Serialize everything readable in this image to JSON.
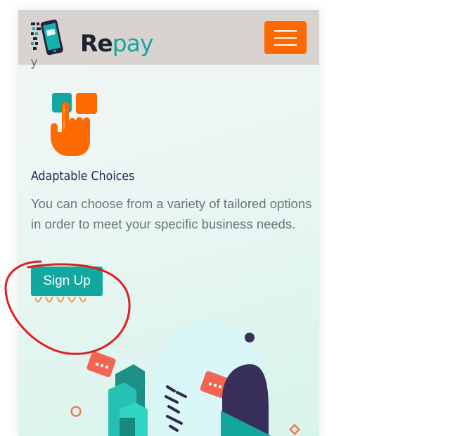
{
  "header": {
    "logo_text_primary": "Re",
    "logo_text_accent": "pay",
    "logo_icon": "phone-payment-icon",
    "menu_icon": "hamburger-icon"
  },
  "feature": {
    "cut_off_text": "y",
    "icon": "tap-choice-icon",
    "title": "Adaptable Choices",
    "description": "You can choose from a variety of tailored options in order to meet your specific business needs."
  },
  "cta": {
    "signup_label": "Sign Up"
  },
  "colors": {
    "accent_orange": "#ff6a00",
    "brand_teal": "#12a8a0",
    "navbar_bg": "#d9d3d0",
    "title_navy": "#1c2450",
    "annotation_red": "#dd1f1f"
  }
}
